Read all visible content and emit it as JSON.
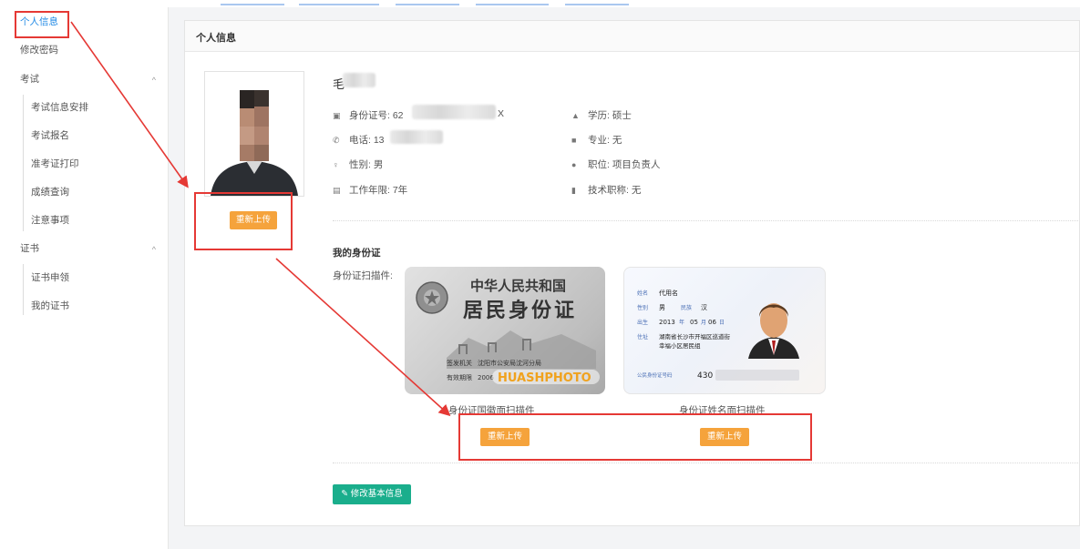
{
  "sidebar": {
    "items": [
      {
        "label": "个人信息",
        "active": true
      },
      {
        "label": "修改密码"
      },
      {
        "label": "考试",
        "expanded": true,
        "children": [
          "考试信息安排",
          "考试报名",
          "准考证打印",
          "成绩查询",
          "注意事项"
        ]
      },
      {
        "label": "证书",
        "expanded": true,
        "children": [
          "证书申领",
          "我的证书"
        ]
      }
    ]
  },
  "panel": {
    "title": "个人信息",
    "name_initial": "毛",
    "reupload_label": "重新上传",
    "fields": {
      "id_label": "身份证号:",
      "id_prefix": "62",
      "id_suffix": "X",
      "phone_label": "电话:",
      "phone_prefix": "13",
      "gender_label": "性别:",
      "gender_value": "男",
      "years_label": "工作年限:",
      "years_value": "7年",
      "education_label": "学历:",
      "education_value": "硕士",
      "major_label": "专业:",
      "major_value": "无",
      "position_label": "职位:",
      "position_value": "项目负责人",
      "title_label": "技术职称:",
      "title_value": "无"
    },
    "id_section": {
      "heading": "我的身份证",
      "scan_label": "身份证扫描件:",
      "front_caption": "身份证国徽面扫描件",
      "back_caption": "身份证姓名面扫描件",
      "front_card": {
        "line1": "中华人民共和国",
        "line2": "居民身份证",
        "authority_label": "签发机关",
        "authority_value": "沈阳市公安局沈河分局",
        "validity_label": "有效期限",
        "validity_value": "2006",
        "watermark": "HUASHPHOTO"
      },
      "back_card": {
        "name_label": "姓名",
        "name_value": "代用名",
        "gender_label": "性别",
        "gender_value": "男",
        "ethnic_label": "民族",
        "ethnic_value": "汉",
        "birth_label": "出生",
        "birth_year": "2013",
        "birth_year_unit": "年",
        "birth_month": "05",
        "birth_month_unit": "月",
        "birth_day": "06",
        "birth_day_unit": "日",
        "address_label": "住址",
        "address_line1": "湖南省长沙市开福区巡道街",
        "address_line2": "幸福小区居民组",
        "id_label": "公民身份证号码",
        "id_prefix": "430"
      }
    },
    "edit_button": "修改基本信息"
  },
  "colors": {
    "accent_blue": "#1e88e5",
    "orange": "#f5a33c",
    "green": "#1aae8c",
    "red_annotation": "#e53935"
  }
}
